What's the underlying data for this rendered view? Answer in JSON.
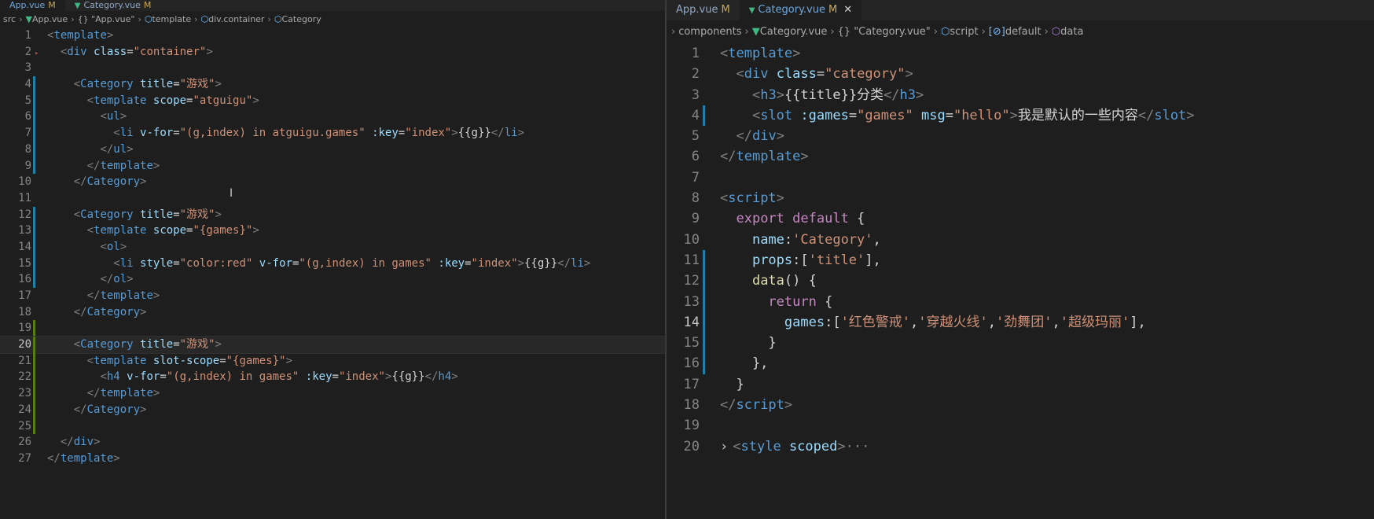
{
  "left": {
    "tabs": [
      {
        "name": "App.vue",
        "modified": "M",
        "active": true
      },
      {
        "name": "Category.vue",
        "modified": "M",
        "active": false
      }
    ],
    "breadcrumbs": [
      "src",
      "App.vue",
      "{} \"App.vue\"",
      "template",
      "div.container",
      "Category"
    ],
    "lines": [
      {
        "n": "1",
        "html": "<span class='bracket'>&lt;</span><span class='tag'>template</span><span class='bracket'>&gt;</span>"
      },
      {
        "n": "2",
        "html": "  <span class='bracket'>&lt;</span><span class='tag'>div</span> <span class='attr'>class</span>=<span class='str'>\"container\"</span><span class='bracket'>&gt;</span>"
      },
      {
        "n": "3",
        "html": ""
      },
      {
        "n": "4",
        "html": "    <span class='bracket'>&lt;</span><span class='tag'>Category</span> <span class='attr'>title</span>=<span class='str'>\"游戏\"</span><span class='bracket'>&gt;</span>"
      },
      {
        "n": "5",
        "html": "      <span class='bracket'>&lt;</span><span class='tag'>template</span> <span class='attr'>scope</span>=<span class='str'>\"atguigu\"</span><span class='bracket'>&gt;</span>"
      },
      {
        "n": "6",
        "html": "        <span class='bracket'>&lt;</span><span class='tag'>ul</span><span class='bracket'>&gt;</span>"
      },
      {
        "n": "7",
        "html": "          <span class='bracket'>&lt;</span><span class='tag'>li</span> <span class='attr'>v-for</span>=<span class='str'>\"(g,index) in atguigu.games\"</span> <span class='attr'>:key</span>=<span class='str'>\"index\"</span><span class='bracket'>&gt;</span>{{g}}<span class='bracket'>&lt;/</span><span class='tag'>li</span><span class='bracket'>&gt;</span>"
      },
      {
        "n": "8",
        "html": "        <span class='bracket'>&lt;/</span><span class='tag'>ul</span><span class='bracket'>&gt;</span>"
      },
      {
        "n": "9",
        "html": "      <span class='bracket'>&lt;/</span><span class='tag'>template</span><span class='bracket'>&gt;</span>"
      },
      {
        "n": "10",
        "html": "    <span class='bracket'>&lt;/</span><span class='tag'>Category</span><span class='bracket'>&gt;</span>"
      },
      {
        "n": "11",
        "html": ""
      },
      {
        "n": "12",
        "html": "    <span class='bracket'>&lt;</span><span class='tag'>Category</span> <span class='attr'>title</span>=<span class='str'>\"游戏\"</span><span class='bracket'>&gt;</span>"
      },
      {
        "n": "13",
        "html": "      <span class='bracket'>&lt;</span><span class='tag'>template</span> <span class='attr'>scope</span>=<span class='str'>\"{games}\"</span><span class='bracket'>&gt;</span>"
      },
      {
        "n": "14",
        "html": "        <span class='bracket'>&lt;</span><span class='tag'>ol</span><span class='bracket'>&gt;</span>"
      },
      {
        "n": "15",
        "html": "          <span class='bracket'>&lt;</span><span class='tag'>li</span> <span class='attr'>style</span>=<span class='str'>\"color:red\"</span> <span class='attr'>v-for</span>=<span class='str'>\"(g,index) in games\"</span> <span class='attr'>:key</span>=<span class='str'>\"index\"</span><span class='bracket'>&gt;</span>{{g}}<span class='bracket'>&lt;/</span><span class='tag'>li</span><span class='bracket'>&gt;</span>"
      },
      {
        "n": "16",
        "html": "        <span class='bracket'>&lt;/</span><span class='tag'>ol</span><span class='bracket'>&gt;</span>"
      },
      {
        "n": "17",
        "html": "      <span class='bracket'>&lt;/</span><span class='tag'>template</span><span class='bracket'>&gt;</span>"
      },
      {
        "n": "18",
        "html": "    <span class='bracket'>&lt;/</span><span class='tag'>Category</span><span class='bracket'>&gt;</span>"
      },
      {
        "n": "19",
        "html": ""
      },
      {
        "n": "20",
        "html": "    <span class='bracket'>&lt;</span><span class='tag'>Category</span> <span class='attr'>title</span>=<span class='str'>\"游戏\"</span><span class='bracket'>&gt;</span>"
      },
      {
        "n": "21",
        "html": "      <span class='bracket'>&lt;</span><span class='tag'>template</span> <span class='attr'>slot-scope</span>=<span class='str'>\"{games}\"</span><span class='bracket'>&gt;</span>"
      },
      {
        "n": "22",
        "html": "        <span class='bracket'>&lt;</span><span class='tag'>h4</span> <span class='attr'>v-for</span>=<span class='str'>\"(g,index) in games\"</span> <span class='attr'>:key</span>=<span class='str'>\"index\"</span><span class='bracket'>&gt;</span>{{g}}<span class='bracket'>&lt;/</span><span class='tag'>h4</span><span class='bracket'>&gt;</span>"
      },
      {
        "n": "23",
        "html": "      <span class='bracket'>&lt;/</span><span class='tag'>template</span><span class='bracket'>&gt;</span>"
      },
      {
        "n": "24",
        "html": "    <span class='bracket'>&lt;/</span><span class='tag'>Category</span><span class='bracket'>&gt;</span>"
      },
      {
        "n": "25",
        "html": ""
      },
      {
        "n": "26",
        "html": "  <span class='bracket'>&lt;/</span><span class='tag'>div</span><span class='bracket'>&gt;</span>"
      },
      {
        "n": "27",
        "html": "<span class='bracket'>&lt;/</span><span class='tag'>template</span><span class='bracket'>&gt;</span>"
      }
    ]
  },
  "right": {
    "tabs": [
      {
        "name": "App.vue",
        "modified": "M",
        "active": false
      },
      {
        "name": "Category.vue",
        "modified": "M",
        "active": true
      }
    ],
    "breadcrumbs": [
      "components",
      "Category.vue",
      "{} \"Category.vue\"",
      "script",
      "default",
      "data"
    ],
    "lines": [
      {
        "n": "1",
        "html": "<span class='bracket'>&lt;</span><span class='tag'>template</span><span class='bracket'>&gt;</span>"
      },
      {
        "n": "2",
        "html": "  <span class='bracket'>&lt;</span><span class='tag'>div</span> <span class='attr'>class</span>=<span class='str'>\"category\"</span><span class='bracket'>&gt;</span>"
      },
      {
        "n": "3",
        "html": "    <span class='bracket'>&lt;</span><span class='tag'>h3</span><span class='bracket'>&gt;</span>{{title}}分类<span class='bracket'>&lt;/</span><span class='tag'>h3</span><span class='bracket'>&gt;</span>"
      },
      {
        "n": "4",
        "html": "    <span class='bracket'>&lt;</span><span class='tag'>slot</span> <span class='attr'>:games</span>=<span class='str'>\"games\"</span> <span class='attr'>msg</span>=<span class='str'>\"hello\"</span><span class='bracket'>&gt;</span>我是默认的一些内容<span class='bracket'>&lt;/</span><span class='tag'>slot</span><span class='bracket'>&gt;</span>"
      },
      {
        "n": "5",
        "html": "  <span class='bracket'>&lt;/</span><span class='tag'>div</span><span class='bracket'>&gt;</span>"
      },
      {
        "n": "6",
        "html": "<span class='bracket'>&lt;/</span><span class='tag'>template</span><span class='bracket'>&gt;</span>"
      },
      {
        "n": "7",
        "html": ""
      },
      {
        "n": "8",
        "html": "<span class='bracket'>&lt;</span><span class='tag'>script</span><span class='bracket'>&gt;</span>"
      },
      {
        "n": "9",
        "html": "  <span class='kw'>export</span> <span class='kw'>default</span> {"
      },
      {
        "n": "10",
        "html": "    <span class='attr'>name</span>:<span class='str'>'Category'</span>,"
      },
      {
        "n": "11",
        "html": "    <span class='attr'>props</span>:[<span class='str'>'title'</span>],"
      },
      {
        "n": "12",
        "html": "    <span class='fn'>data</span>() {"
      },
      {
        "n": "13",
        "html": "      <span class='kw'>return</span> {"
      },
      {
        "n": "14",
        "html": "        <span class='attr'>games</span>:[<span class='str'>'红色警戒'</span>,<span class='str'>'穿越火线'</span>,<span class='str'>'劲舞团'</span>,<span class='str'>'超级玛丽'</span>],"
      },
      {
        "n": "15",
        "html": "      }"
      },
      {
        "n": "16",
        "html": "    },"
      },
      {
        "n": "17",
        "html": "  }"
      },
      {
        "n": "18",
        "html": "<span class='bracket'>&lt;/</span><span class='tag'>script</span><span class='bracket'>&gt;</span>"
      },
      {
        "n": "19",
        "html": ""
      },
      {
        "n": "20",
        "html": "<span class='bracket'>&lt;</span><span class='tag'>style</span> <span class='attr'>scoped</span><span class='bracket'>&gt;</span><span class='bracket'>···</span>"
      }
    ]
  }
}
